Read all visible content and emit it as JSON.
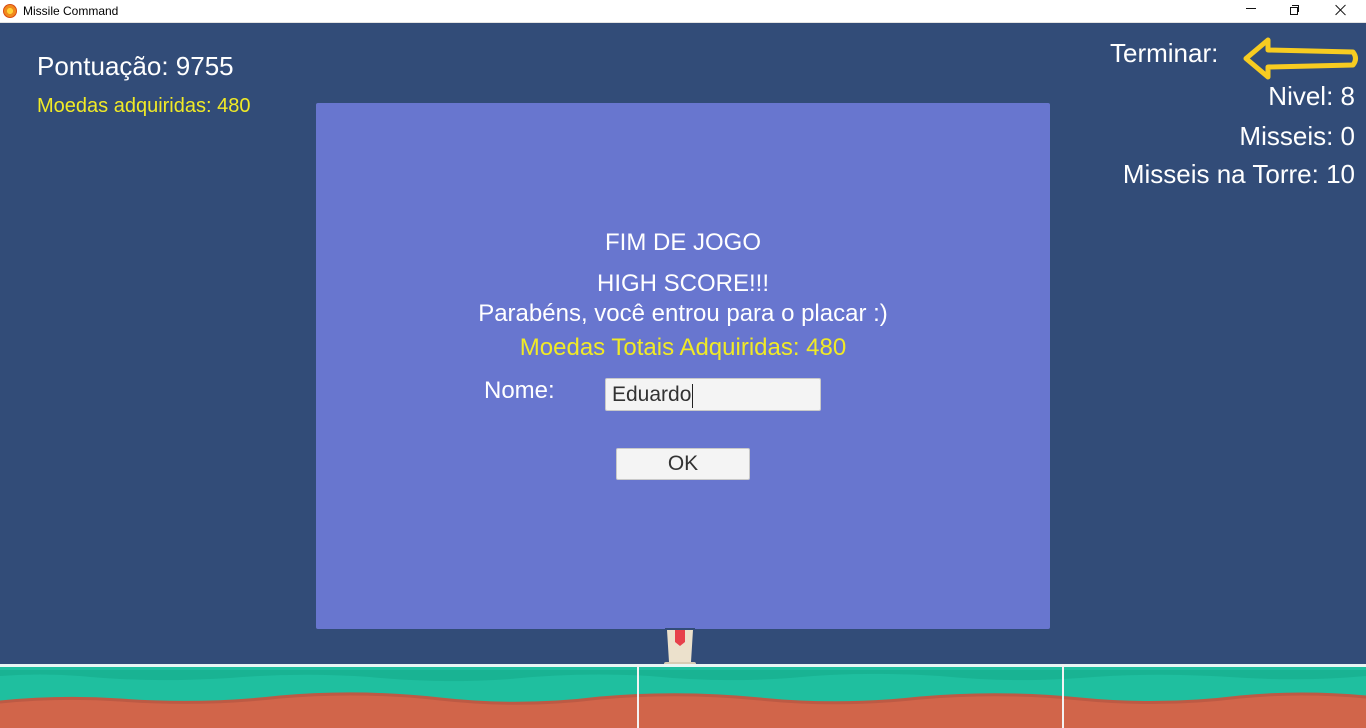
{
  "window": {
    "title": "Missile Command"
  },
  "hud": {
    "score_text": "Pontuação: 9755",
    "coins_text": "Moedas adquiridas: 480",
    "exit_label": "Terminar:",
    "level_text": "Nivel: 8",
    "missiles_text": "Misseis: 0",
    "tower_missiles_text": "Misseis na Torre: 10"
  },
  "dialog": {
    "game_over": "FIM DE JOGO",
    "high_score": "HIGH SCORE!!!",
    "congrats": "Parabéns, você entrou para o placar :)",
    "total_coins": "Moedas Totais Adquiridas: 480",
    "name_label": "Nome:",
    "name_value": "Eduardo",
    "ok_label": "OK"
  },
  "colors": {
    "background": "#324c78",
    "panel": "#6876cf",
    "highlight_text": "#f1ea26",
    "arrow": "#f7cc21",
    "grass": "#1fbf9f",
    "dirt": "#d1654a"
  },
  "icons": {
    "app": "missile-command-app-icon",
    "exit": "arrow-left-icon"
  }
}
